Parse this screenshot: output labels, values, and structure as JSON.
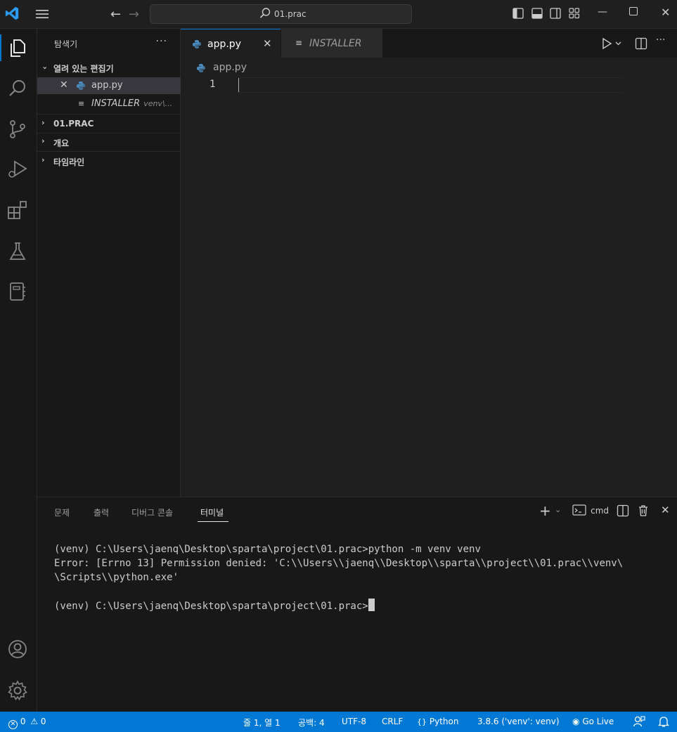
{
  "colors": {
    "accent": "#0078d4",
    "statusbar": "#0078d4",
    "background": "#1f1f1f",
    "python_icon": "#4b8bbe"
  },
  "titlebar": {
    "search_text": "01.prac"
  },
  "activitybar": {
    "items": [
      "explorer-icon",
      "search-icon",
      "source-control-icon",
      "run-debug-icon",
      "extensions-icon",
      "testing-icon",
      "notebook-icon"
    ],
    "bottom": [
      "account-icon",
      "settings-gear-icon"
    ]
  },
  "sidebar": {
    "title": "탐색기",
    "open_editors": {
      "label": "열려 있는 편집기",
      "items": [
        {
          "name": "app.py",
          "desc": ""
        },
        {
          "name": "INSTALLER",
          "desc": "venv\\..."
        }
      ]
    },
    "sections": [
      "01.PRAC",
      "개요",
      "타임라인"
    ]
  },
  "editor": {
    "tabs": [
      {
        "label": "app.py",
        "active": true
      },
      {
        "label": "INSTALLER",
        "active": false
      }
    ],
    "breadcrumb": "app.py",
    "line_number": "1"
  },
  "panel": {
    "tabs": [
      "문제",
      "출력",
      "디버그 콘솔",
      "터미널"
    ],
    "active_tab": "터미널",
    "terminal_profile": "cmd",
    "terminal_lines": [
      "(venv) C:\\Users\\jaenq\\Desktop\\sparta\\project\\01.prac>python -m venv venv",
      "Error: [Errno 13] Permission denied: 'C:\\\\Users\\\\jaenq\\\\Desktop\\\\sparta\\\\project\\\\01.prac\\\\venv\\",
      "\\Scripts\\\\python.exe'",
      "",
      "(venv) C:\\Users\\jaenq\\Desktop\\sparta\\project\\01.prac>"
    ]
  },
  "statusbar": {
    "errors": "0",
    "warnings": "0",
    "position": "줄 1, 열 1",
    "spaces": "공백: 4",
    "encoding": "UTF-8",
    "eol": "CRLF",
    "language": "Python",
    "interpreter": "3.8.6 ('venv': venv)",
    "golive": "Go Live"
  }
}
